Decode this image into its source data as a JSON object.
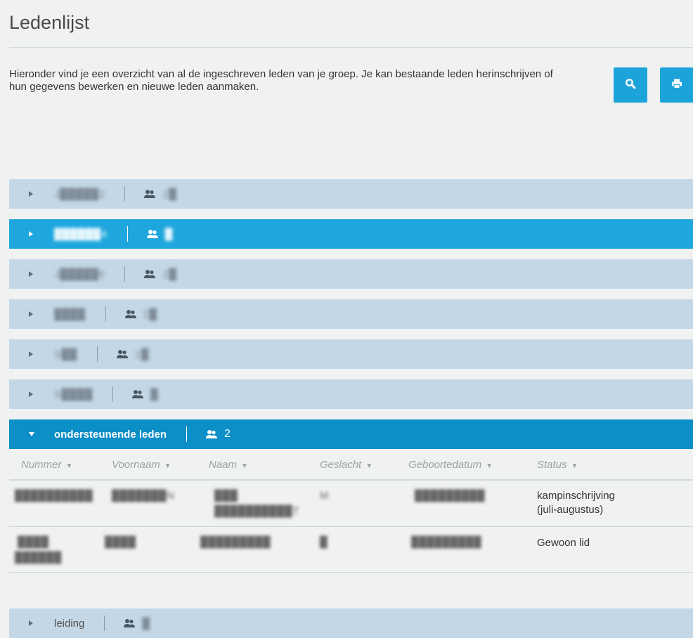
{
  "page": {
    "title": "Ledenlijst",
    "intro": "Hieronder vind je een overzicht van al de ingeschreven leden van je groep. Je kan bestaande leden herinschrijven of hun gegevens bewerken en nieuwe leden aanmaken."
  },
  "toolbar": {
    "search_icon": "search-icon",
    "print_icon": "print-icon",
    "accent_color": "#1ca3d9"
  },
  "groups": [
    {
      "name": "J█████2",
      "count": "2█",
      "state": "collapsed"
    },
    {
      "name": "██████4",
      "count": "█",
      "state": "highlighted"
    },
    {
      "name": "J█████6",
      "count": "2█",
      "state": "collapsed"
    },
    {
      "name": "████",
      "count": "2█",
      "state": "collapsed"
    },
    {
      "name": "S██",
      "count": "1█",
      "state": "collapsed"
    },
    {
      "name": "S████",
      "count": "█",
      "state": "collapsed"
    },
    {
      "name": "ondersteunende leden",
      "count": "2",
      "state": "expanded"
    },
    {
      "name": "leiding",
      "count": "█",
      "state": "collapsed"
    }
  ],
  "table": {
    "columns": [
      "Nummer",
      "Voornaam",
      "Naam",
      "Geslacht",
      "Geboortedatum",
      "Status"
    ],
    "rows": [
      {
        "nummer": "██████████",
        "voornaam": "███████N",
        "naam_line1": "███",
        "naam_line2": "██████████T",
        "geslacht": "M",
        "geboortedatum": "█████████",
        "status_line1": "kampinschrijving",
        "status_line2": "(juli-augustus)"
      },
      {
        "nummer": "████",
        "nummer_line2": "██████",
        "voornaam": "████",
        "naam_line1": "█████████",
        "naam_line2": "",
        "geslacht": "█",
        "geboortedatum": "█████████",
        "status_line1": "Gewoon lid",
        "status_line2": ""
      }
    ]
  },
  "colors": {
    "group_bg": "#c3d7e6",
    "group_highlight": "#1fa7dd",
    "group_open": "#0c8ec6"
  }
}
